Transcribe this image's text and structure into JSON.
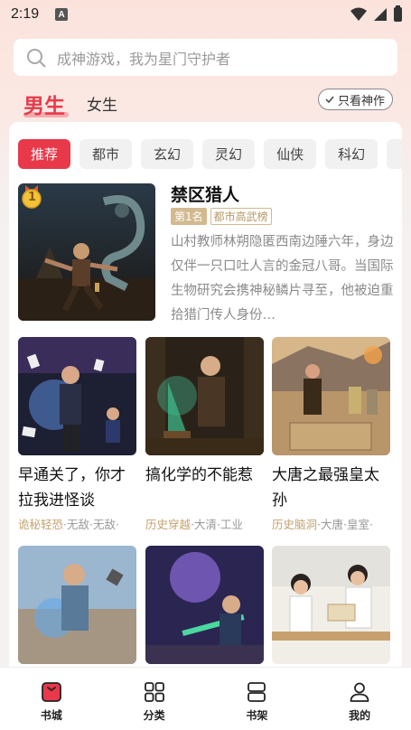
{
  "status_bar": {
    "time": "2:19",
    "notification_letter": "A",
    "icons": [
      "wifi-icon",
      "signal-icon",
      "battery-icon"
    ]
  },
  "search": {
    "placeholder": "成神游戏，我为星门守护者",
    "icon": "search-icon"
  },
  "gender_tabs": {
    "male": "男生",
    "female": "女生",
    "filter_button": "只看神作"
  },
  "categories": [
    "推荐",
    "都市",
    "玄幻",
    "灵幻",
    "仙侠",
    "科幻"
  ],
  "colors": {
    "accent": "#e8394a",
    "tag_gold": "#d2b98f",
    "badge_gold": "#f2c23a"
  },
  "featured": {
    "rank_badge": "1",
    "title": "禁区猎人",
    "rank_tag": "第1名",
    "genre_tag": "都市高武榜",
    "description": "山村教师林朔隐匿西南边陲六年，身边仅伴一只口吐人言的金冠八哥。当国际生物研究会携神秘鳞片寻至，他被迫重拾猎门传人身份…"
  },
  "books": [
    {
      "title": "早通关了，你才拉我进怪谈",
      "tag_main": "诡秘轻恐",
      "tags_rest": "·无敌·无敌·"
    },
    {
      "title": "搞化学的不能惹",
      "tag_main": "历史穿越",
      "tags_rest": "·大清·工业"
    },
    {
      "title": "大唐之最强皇太孙",
      "tag_main": "历史脑洞",
      "tags_rest": "·大唐·皇室·"
    },
    {
      "title": "",
      "tag_main": "",
      "tags_rest": ""
    },
    {
      "title": "",
      "tag_main": "",
      "tags_rest": ""
    },
    {
      "title": "",
      "tag_main": "",
      "tags_rest": ""
    }
  ],
  "bottom_nav": [
    {
      "label": "书城",
      "icon": "bookstore-icon",
      "active": true
    },
    {
      "label": "分类",
      "icon": "grid-icon",
      "active": false
    },
    {
      "label": "书架",
      "icon": "bookshelf-icon",
      "active": false
    },
    {
      "label": "我的",
      "icon": "user-icon",
      "active": false
    }
  ]
}
